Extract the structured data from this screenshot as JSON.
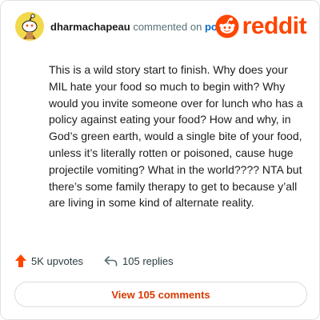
{
  "header": {
    "username": "dharmachapeau",
    "action_text": "commented on",
    "post_link": "post",
    "brand": "reddit",
    "avatar_icon": "snoo-avatar-icon",
    "brand_icon": "reddit-logo-icon"
  },
  "comment": {
    "text": "This is a wild story start to finish. Why does your MIL hate your food so much to begin with? Why would you invite someone over for lunch who has a policy against eating your food? How and why, in God’s green earth, would a single bite of your food, unless it’s literally rotten or poisoned, cause huge projectile vomiting? What in the world???? NTA but there’s some family therapy to get to because y’all are living in some kind of alternate reality."
  },
  "actions": {
    "upvotes": "5K upvotes",
    "replies": "105 replies",
    "upvote_icon": "upvote-arrow-icon",
    "reply_icon": "reply-arrow-icon"
  },
  "view_comments_label": "View 105 comments",
  "colors": {
    "brand": "#ff4500",
    "link": "#0a6cc9",
    "button_text": "#d93900",
    "avatar_bg": "#f2d84b"
  }
}
